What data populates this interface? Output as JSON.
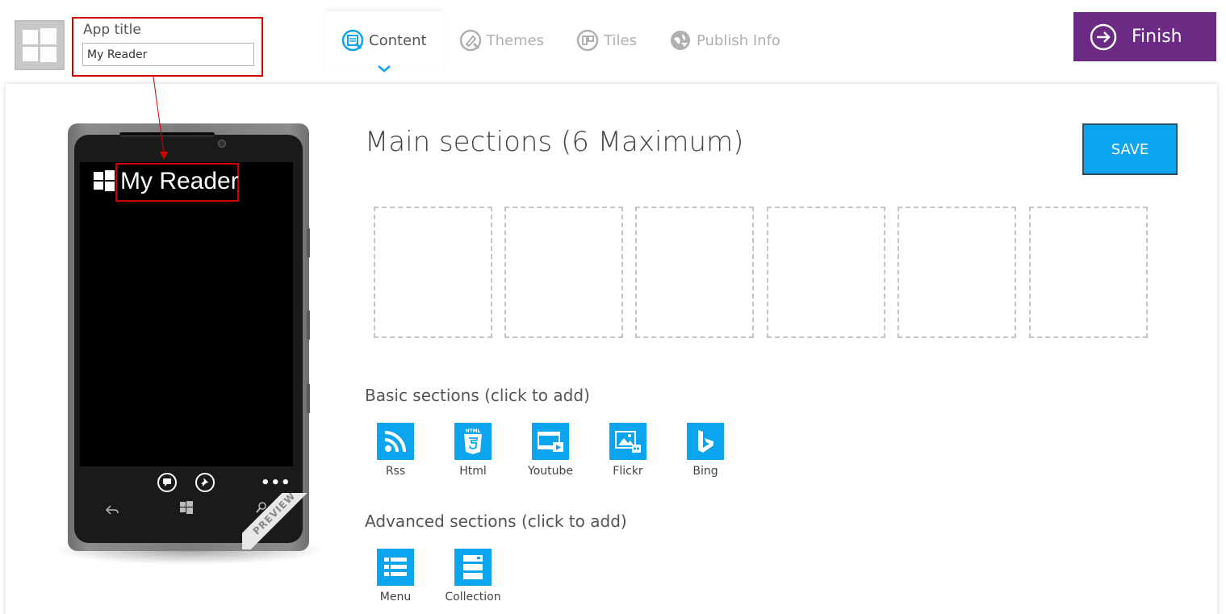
{
  "header": {
    "app_title_label": "App title",
    "app_title_value": "My Reader",
    "tabs": [
      {
        "label": "Content",
        "icon": "content-icon",
        "active": true
      },
      {
        "label": "Themes",
        "icon": "themes-icon",
        "active": false
      },
      {
        "label": "Tiles",
        "icon": "tiles-icon",
        "active": false
      },
      {
        "label": "Publish Info",
        "icon": "publish-info-icon",
        "active": false
      }
    ],
    "finish_label": "Finish"
  },
  "preview": {
    "app_title": "My Reader",
    "ribbon": "PREVIEW"
  },
  "main": {
    "heading": "Main sections (6 Maximum)",
    "save_label": "SAVE",
    "slot_count": 6,
    "basic_label": "Basic sections (click to add)",
    "basic_sections": [
      {
        "label": "Rss",
        "icon": "rss-icon"
      },
      {
        "label": "Html",
        "icon": "html5-icon"
      },
      {
        "label": "Youtube",
        "icon": "video-icon"
      },
      {
        "label": "Flickr",
        "icon": "image-icon"
      },
      {
        "label": "Bing",
        "icon": "bing-icon"
      }
    ],
    "advanced_label": "Advanced sections (click to add)",
    "advanced_sections": [
      {
        "label": "Menu",
        "icon": "menu-list-icon"
      },
      {
        "label": "Collection",
        "icon": "collection-icon"
      }
    ]
  },
  "colors": {
    "accent": "#0ba5ef",
    "finish": "#6b2a83",
    "highlight": "#d10000"
  }
}
